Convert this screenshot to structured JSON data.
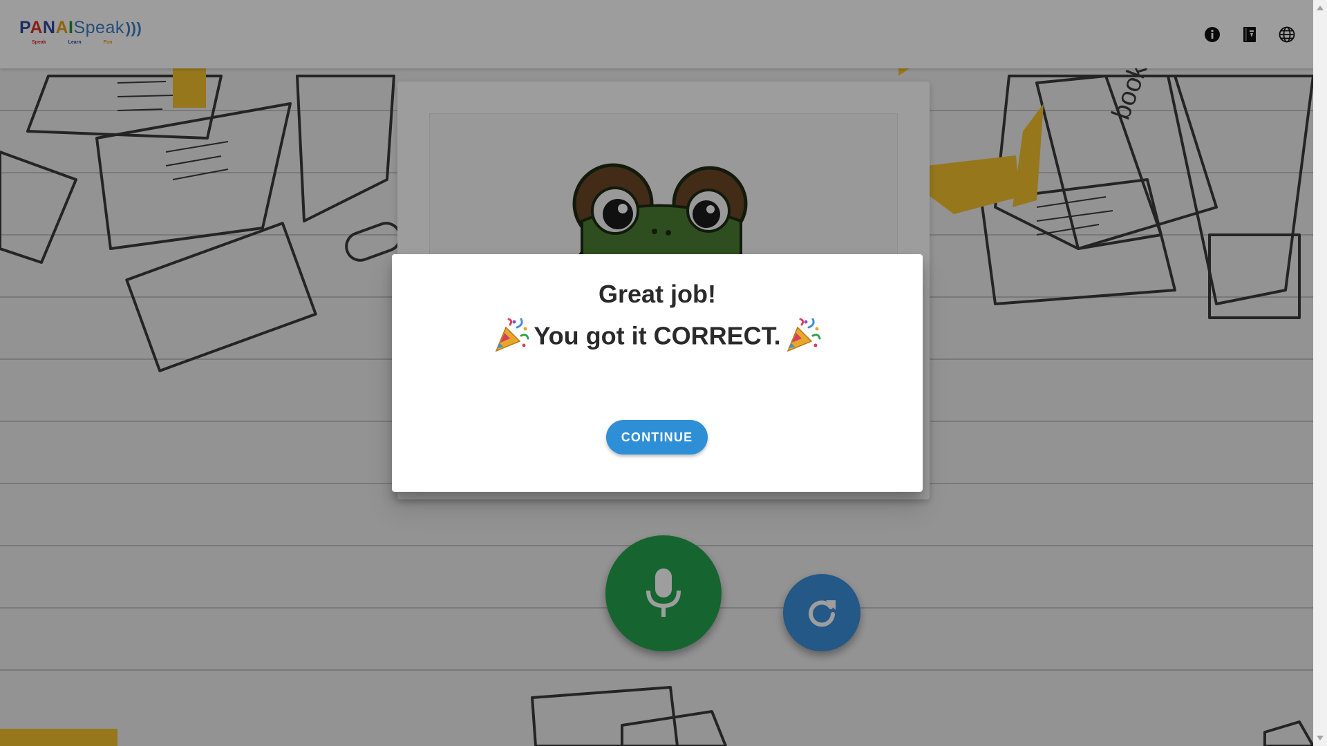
{
  "app": {
    "logo": {
      "letters": [
        "P",
        "A",
        "N",
        "A",
        "I"
      ],
      "word": "Speak",
      "waves": ")))",
      "taglines": [
        "Speak",
        "Learn",
        "Fun"
      ]
    },
    "toolbar_icons": [
      "info-icon",
      "book-icon",
      "globe-icon"
    ]
  },
  "card": {
    "image_subject": "frog-illustration"
  },
  "controls": {
    "mic_icon": "microphone-icon",
    "refresh_icon": "refresh-icon",
    "mic_color": "#25a450",
    "refresh_color": "#3b8fd9"
  },
  "dialog": {
    "title": "Great job!",
    "message": "You got it CORRECT.",
    "message_icon": "party-popper-icon",
    "continue_label": "CONTINUE",
    "accent_color": "#2f8fd6"
  }
}
